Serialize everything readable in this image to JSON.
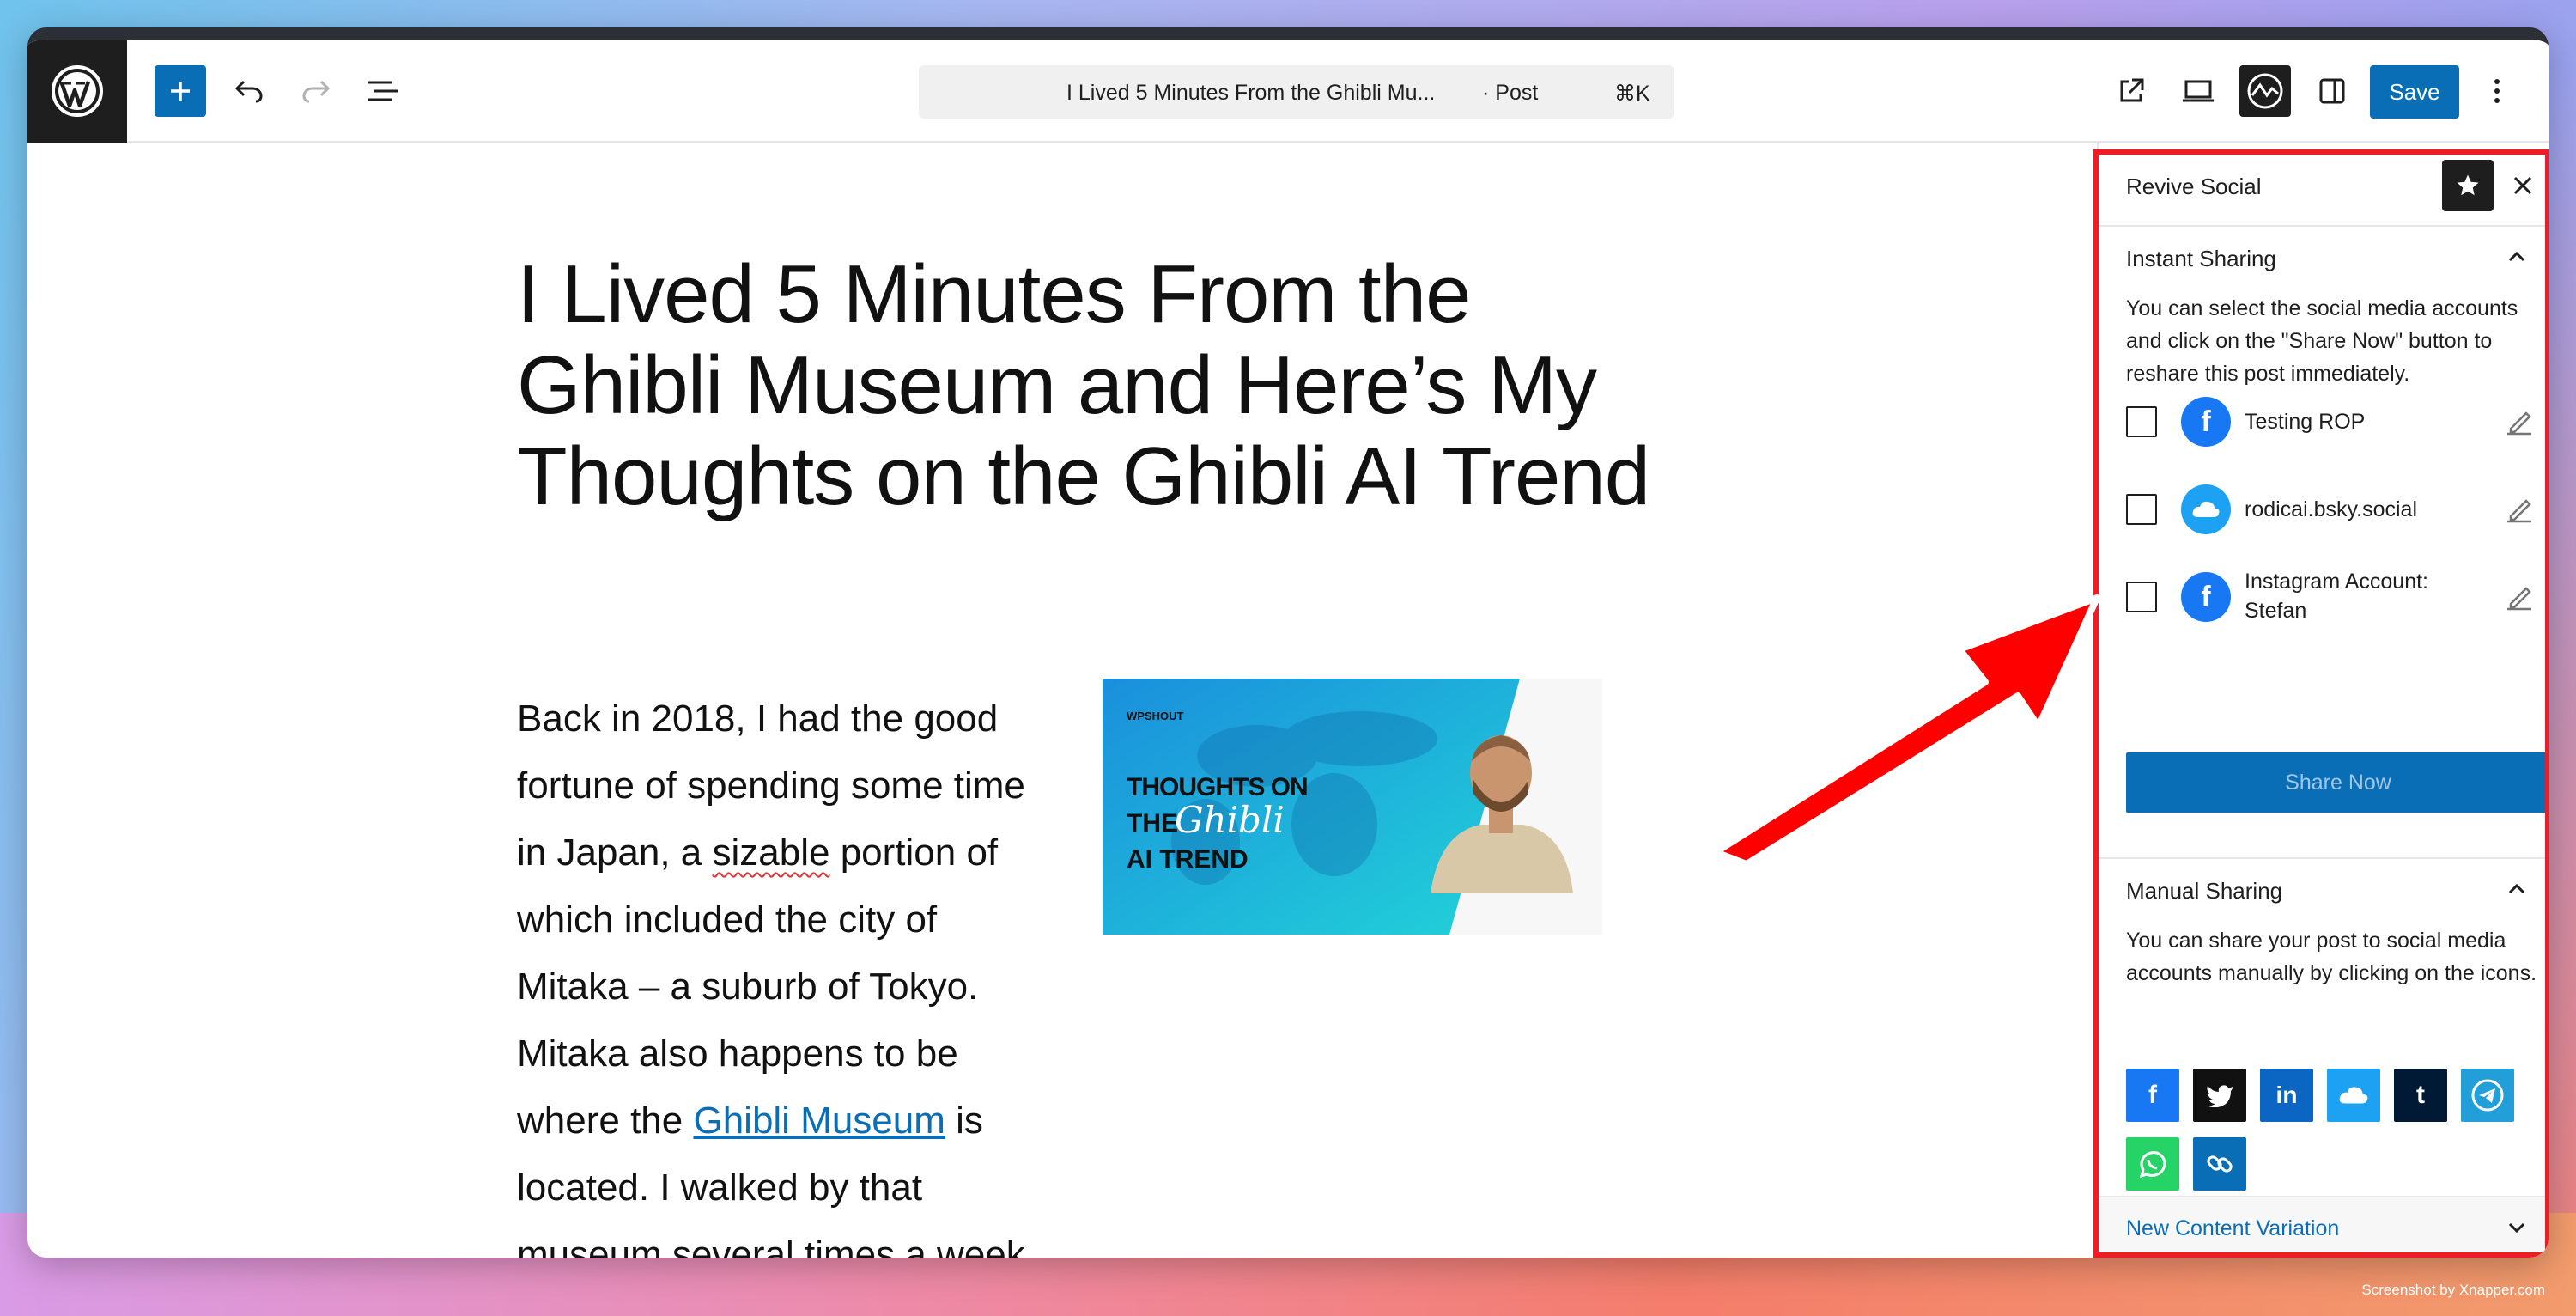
{
  "window": {
    "command_bar": {
      "title": "I Lived 5 Minutes From the Ghibli Mu...",
      "type": "· Post",
      "shortcut": "⌘K"
    },
    "toolbar": {
      "save_label": "Save"
    }
  },
  "editor": {
    "post_title": "I Lived 5 Minutes From the Ghibli Museum and Here’s My Thoughts on the Ghibli AI Trend",
    "paragraph": {
      "part1": "Back in 2018, I had the good fortune of spending some time in Japan, a ",
      "squiggle_word": "sizable",
      "part2": " portion of which included the city of Mitaka – a suburb of Tokyo. Mitaka also happens to be where the ",
      "link_text": "Ghibli Museum",
      "part3": " is located. I walked by that museum several times a week"
    },
    "featured_image": {
      "brand": "WPSHOUT",
      "line1": "THOUGHTS ON",
      "line2": "THE",
      "script_word": "Ghibli",
      "line3": "AI TREND"
    }
  },
  "sidebar": {
    "title": "Revive Social",
    "instant_sharing": {
      "label": "Instant Sharing",
      "description": "You can select the social media accounts and click on the \"Share Now\" button to reshare this post immediately.",
      "accounts": [
        {
          "name": "Testing ROP",
          "network_icon": "facebook-icon"
        },
        {
          "name": "rodicai.bsky.social",
          "network_icon": "bluesky-icon"
        },
        {
          "name": "Instagram Account: Stefan",
          "network_icon": "facebook-icon"
        }
      ],
      "share_now_label": "Share Now"
    },
    "manual_sharing": {
      "label": "Manual Sharing",
      "description": "You can share your post to social media accounts manually by clicking on the icons.",
      "networks": [
        {
          "name": "facebook",
          "color": "#1877f2"
        },
        {
          "name": "twitter",
          "color": "#111111"
        },
        {
          "name": "linkedin",
          "color": "#0a66c2"
        },
        {
          "name": "bluesky",
          "color": "#1da1f2"
        },
        {
          "name": "tumblr",
          "color": "#001935"
        },
        {
          "name": "telegram",
          "color": "#229ed9"
        },
        {
          "name": "whatsapp",
          "color": "#25d366"
        },
        {
          "name": "copy-link",
          "color": "#0a6eb6"
        }
      ]
    },
    "new_content_variation": {
      "label": "New Content Variation"
    }
  },
  "footer": {
    "credit": "Screenshot by Xnapper.com"
  },
  "colors": {
    "accent": "#0a6eb6",
    "highlight": "#ee1c24",
    "arrow": "#ff0000"
  }
}
